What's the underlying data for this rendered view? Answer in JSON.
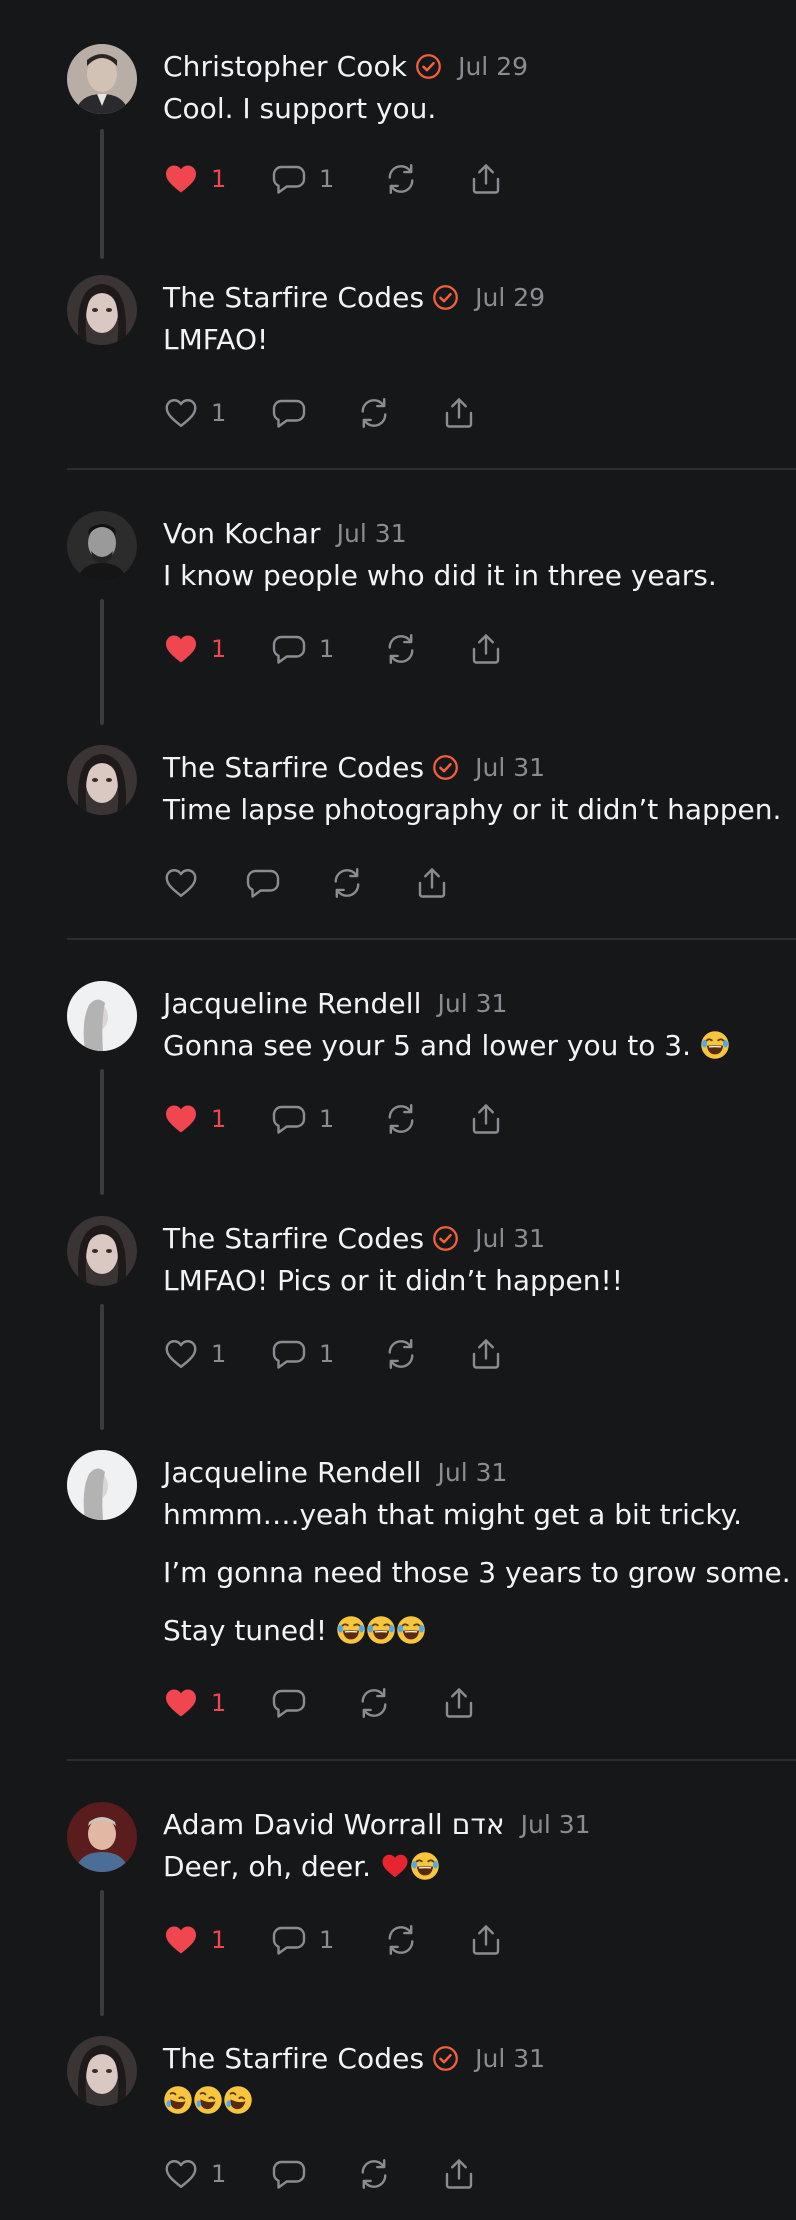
{
  "colors": {
    "background": "#161719",
    "accent_verified": "#f4603a",
    "like_active": "#ef4650",
    "muted": "#8b8c91"
  },
  "posts": [
    {
      "author": "Christopher Cook",
      "verified": true,
      "date": "Jul 29",
      "lines": [
        "Cool. I support you."
      ],
      "likes": "1",
      "liked": true,
      "replies": "1"
    },
    {
      "author": "The Starfire Codes",
      "verified": true,
      "date": "Jul 29",
      "lines": [
        "LMFAO!"
      ],
      "likes": "1",
      "liked": false,
      "replies": ""
    },
    {
      "author": "Von Kochar",
      "verified": false,
      "date": "Jul 31",
      "lines": [
        "I know people who did it in three years."
      ],
      "likes": "1",
      "liked": true,
      "replies": "1"
    },
    {
      "author": "The Starfire Codes",
      "verified": true,
      "date": "Jul 31",
      "lines": [
        "Time lapse photography or it didn’t happen."
      ],
      "likes": "",
      "liked": false,
      "replies": ""
    },
    {
      "author": "Jacqueline Rendell",
      "verified": false,
      "date": "Jul 31",
      "lines": [
        "Gonna see your 5 and lower you to 3."
      ],
      "likes": "1",
      "liked": true,
      "replies": "1"
    },
    {
      "author": "The Starfire Codes",
      "verified": true,
      "date": "Jul 31",
      "lines": [
        "LMFAO! Pics or it didn’t happen!!"
      ],
      "likes": "1",
      "liked": false,
      "replies": "1"
    },
    {
      "author": "Jacqueline Rendell",
      "verified": false,
      "date": "Jul 31",
      "lines": [
        "hmmm….yeah that might get a bit tricky.",
        "I’m gonna need those 3 years to grow some.",
        "Stay tuned!"
      ],
      "likes": "1",
      "liked": true,
      "replies": ""
    },
    {
      "author": "Adam David Worrall אדם",
      "verified": false,
      "date": "Jul 31",
      "lines": [
        "Deer, oh, deer."
      ],
      "likes": "1",
      "liked": true,
      "replies": "1"
    },
    {
      "author": "The Starfire Codes",
      "verified": true,
      "date": "Jul 31",
      "lines": [
        ""
      ],
      "likes": "1",
      "liked": false,
      "replies": ""
    }
  ]
}
